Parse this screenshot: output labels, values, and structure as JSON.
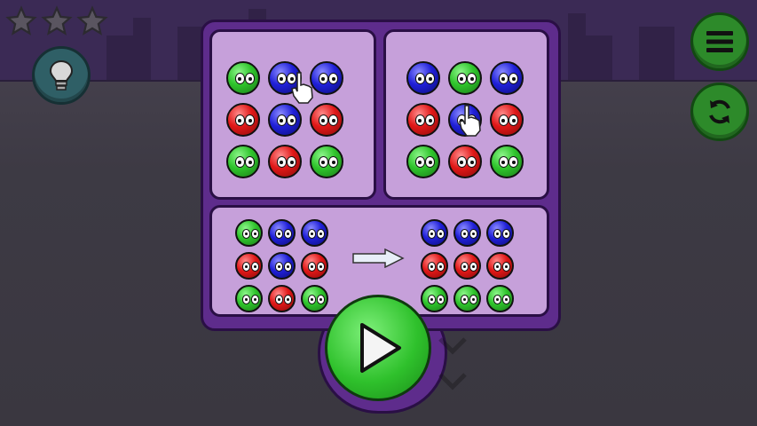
{
  "game": {
    "stars": {
      "earned": 0,
      "total": 3
    },
    "hint_button": {
      "icon": "lightbulb-icon"
    },
    "menu_button": {
      "icon": "hamburger-menu-icon"
    },
    "restart_button": {
      "icon": "restart-icon"
    },
    "play_button": {
      "icon": "play-icon"
    }
  },
  "tutorial": {
    "panel_row_swipe": {
      "rows": [
        [
          "green",
          "blue",
          "blue"
        ],
        [
          "red",
          "blue",
          "red"
        ],
        [
          "green",
          "red",
          "green"
        ]
      ]
    },
    "panel_column_swipe": {
      "rows": [
        [
          "blue",
          "green",
          "blue"
        ],
        [
          "red",
          "blue",
          "red"
        ],
        [
          "green",
          "red",
          "green"
        ]
      ]
    },
    "goal": {
      "before": [
        [
          "green",
          "blue",
          "blue"
        ],
        [
          "red",
          "blue",
          "red"
        ],
        [
          "green",
          "red",
          "green"
        ]
      ],
      "after": [
        [
          "blue",
          "blue",
          "blue"
        ],
        [
          "red",
          "red",
          "red"
        ],
        [
          "green",
          "green",
          "green"
        ]
      ]
    }
  },
  "colors": {
    "green": "#2fc42c",
    "red": "#e01818",
    "blue": "#2020d8",
    "panel": "#5e2c8c",
    "card": "#c6a0da"
  }
}
